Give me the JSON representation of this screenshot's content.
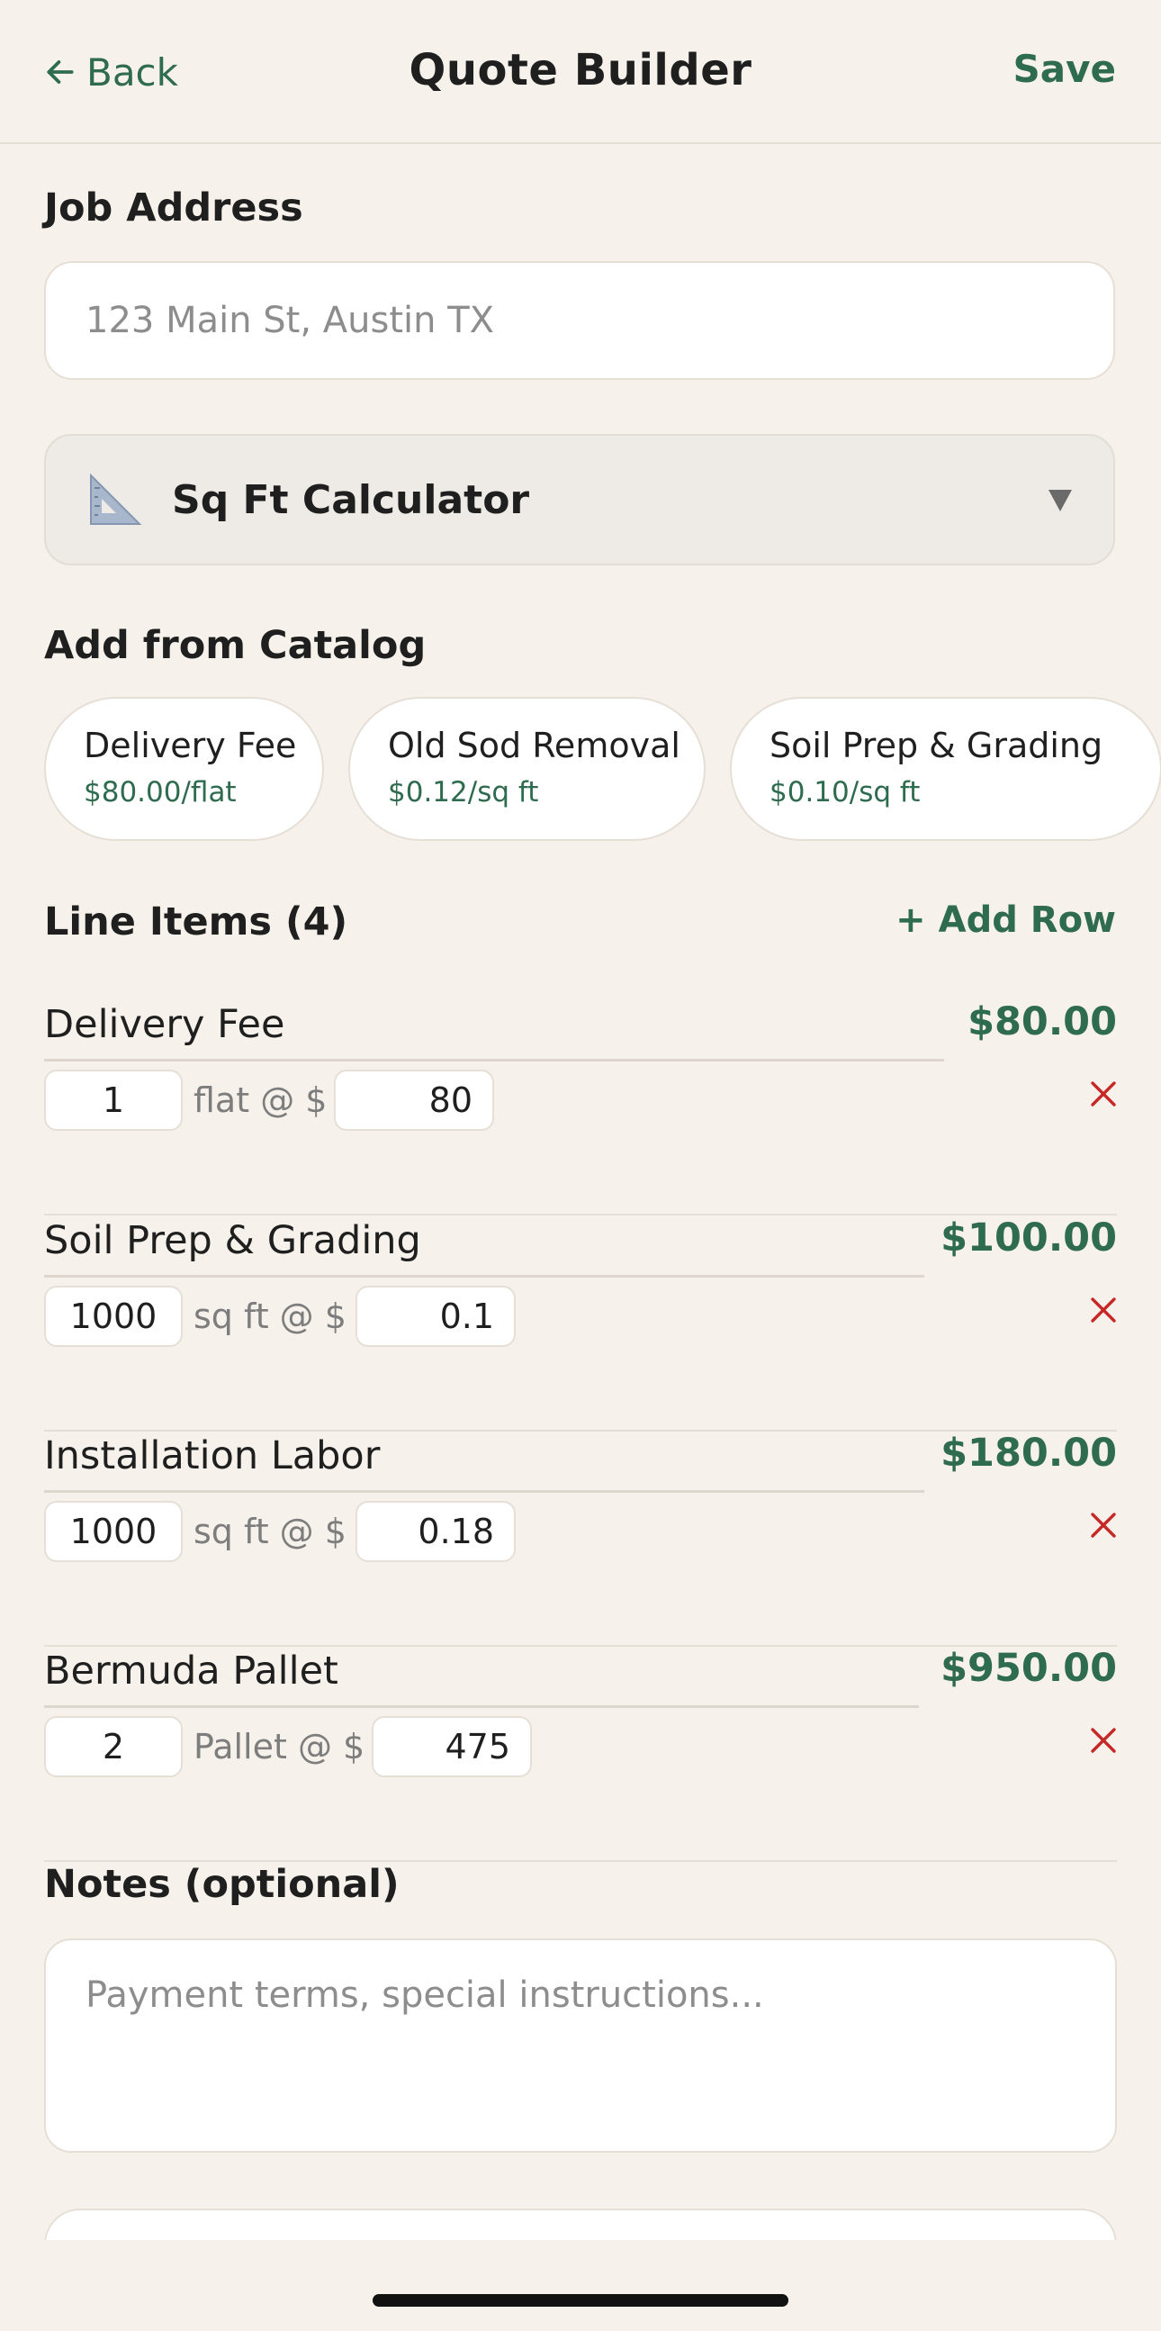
{
  "header": {
    "back_label": "Back",
    "title": "Quote Builder",
    "save_label": "Save"
  },
  "job_address": {
    "label": "Job Address",
    "placeholder": "123 Main St, Austin TX"
  },
  "calculator": {
    "label": "Sq Ft Calculator",
    "icon": "triangle-ruler-icon"
  },
  "catalog": {
    "label": "Add from Catalog",
    "items": [
      {
        "name": "Delivery Fee",
        "price": "$80.00/flat"
      },
      {
        "name": "Old Sod Removal",
        "price": "$0.12/sq ft"
      },
      {
        "name": "Soil Prep & Grading",
        "price": "$0.10/sq ft"
      }
    ]
  },
  "line_items": {
    "label": "Line Items (4)",
    "add_row_label": "+ Add Row",
    "items": [
      {
        "name": "Delivery Fee",
        "total": "$80.00",
        "qty": "1",
        "unit": "flat @ $",
        "price": "80"
      },
      {
        "name": "Soil Prep & Grading",
        "total": "$100.00",
        "qty": "1000",
        "unit": "sq ft @ $",
        "price": "0.1"
      },
      {
        "name": "Installation Labor",
        "total": "$180.00",
        "qty": "1000",
        "unit": "sq ft @ $",
        "price": "0.18"
      },
      {
        "name": "Bermuda Pallet",
        "total": "$950.00",
        "qty": "2",
        "unit": "Pallet @ $",
        "price": "475"
      }
    ]
  },
  "notes": {
    "label": "Notes (optional)",
    "placeholder": "Payment terms, special instructions..."
  },
  "colors": {
    "accent": "#2f6b4f",
    "background": "#f6f1eb",
    "remove": "#c62828"
  }
}
